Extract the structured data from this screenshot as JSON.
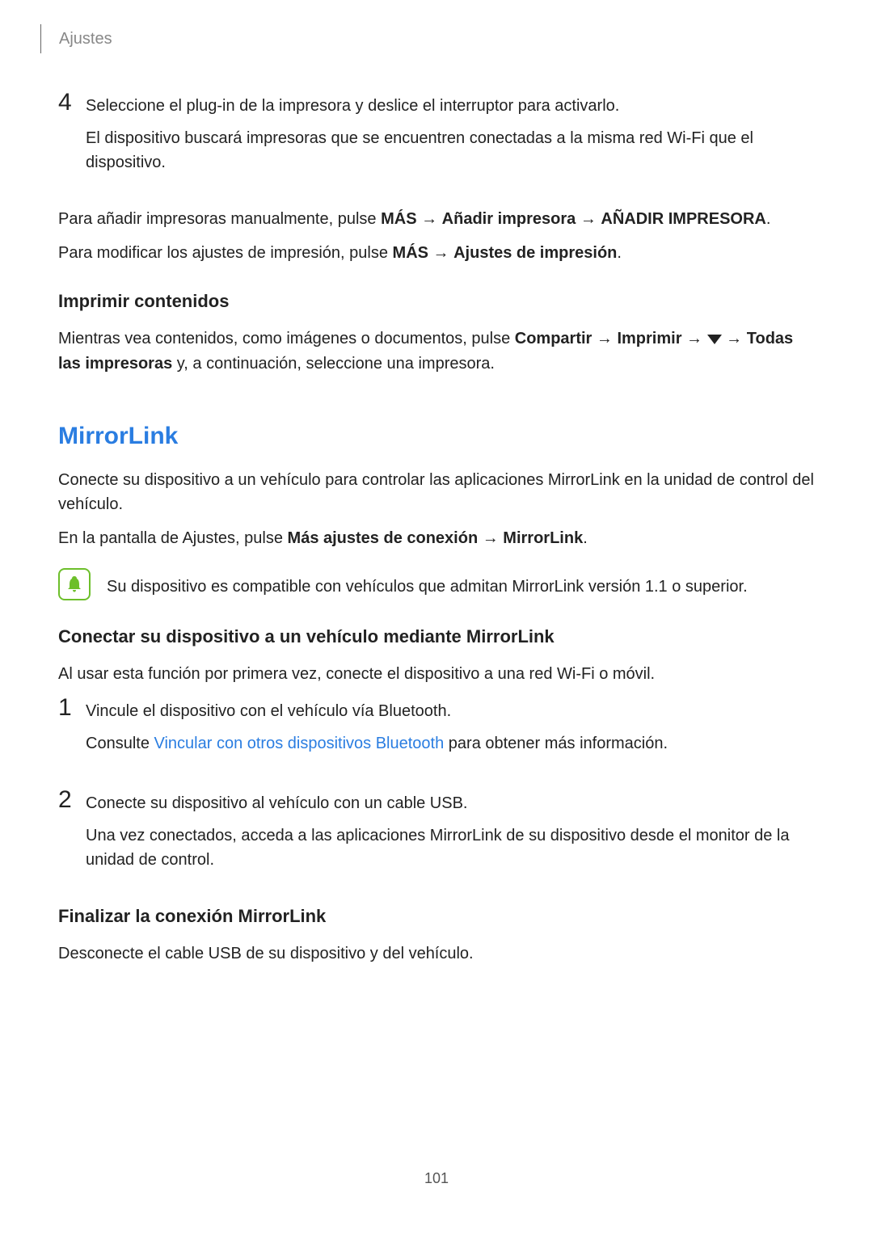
{
  "header": {
    "section": "Ajustes"
  },
  "step4": {
    "num": "4",
    "line1": "Seleccione el plug-in de la impresora y deslice el interruptor para activarlo.",
    "line2": "El dispositivo buscará impresoras que se encuentren conectadas a la misma red Wi-Fi que el dispositivo."
  },
  "para1": {
    "pre": "Para añadir impresoras manualmente, pulse ",
    "mas": "MÁS",
    "arrow1": " → ",
    "anadir": "Añadir impresora",
    "arrow2": " → ",
    "anadir_caps": "AÑADIR IMPRESORA",
    "period": "."
  },
  "para2": {
    "pre": "Para modificar los ajustes de impresión, pulse ",
    "mas": "MÁS",
    "arrow": " → ",
    "ajustes": "Ajustes de impresión",
    "period": "."
  },
  "h3_1": "Imprimir contenidos",
  "para3": {
    "pre": "Mientras vea contenidos, como imágenes o documentos, pulse ",
    "compartir": "Compartir",
    "arrow1": " → ",
    "imprimir": "Imprimir",
    "arrow2": " → ",
    "arrow3": " → ",
    "todas": "Todas las impresoras",
    "post": " y, a continuación, seleccione una impresora."
  },
  "h2_1": "MirrorLink",
  "ml_p1": "Conecte su dispositivo a un vehículo para controlar las aplicaciones MirrorLink en la unidad de control del vehículo.",
  "ml_p2": {
    "pre": "En la pantalla de Ajustes, pulse ",
    "bold1": "Más ajustes de conexión",
    "arrow": " → ",
    "bold2": "MirrorLink",
    "period": "."
  },
  "note": "Su dispositivo es compatible con vehículos que admitan MirrorLink versión 1.1 o superior.",
  "h3_2": "Conectar su dispositivo a un vehículo mediante MirrorLink",
  "conn_p1": "Al usar esta función por primera vez, conecte el dispositivo a una red Wi-Fi o móvil.",
  "step1": {
    "num": "1",
    "line1": "Vincule el dispositivo con el vehículo vía Bluetooth.",
    "line2_pre": "Consulte ",
    "line2_link": "Vincular con otros dispositivos Bluetooth",
    "line2_post": " para obtener más información."
  },
  "step2": {
    "num": "2",
    "line1": "Conecte su dispositivo al vehículo con un cable USB.",
    "line2": "Una vez conectados, acceda a las aplicaciones MirrorLink de su dispositivo desde el monitor de la unidad de control."
  },
  "h3_3": "Finalizar la conexión MirrorLink",
  "fin_p1": "Desconecte el cable USB de su dispositivo y del vehículo.",
  "page_number": "101"
}
